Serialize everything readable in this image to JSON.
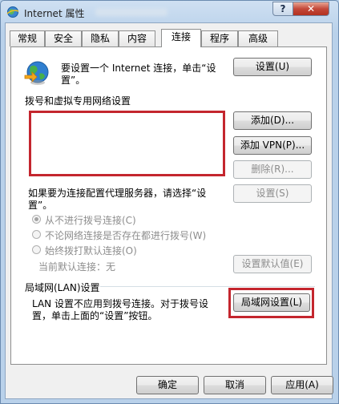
{
  "window": {
    "title": "Internet 属性",
    "help_label": "?",
    "close_label": "✕"
  },
  "tabs": [
    {
      "label": "常规"
    },
    {
      "label": "安全"
    },
    {
      "label": "隐私"
    },
    {
      "label": "内容"
    },
    {
      "label": "连接"
    },
    {
      "label": "程序"
    },
    {
      "label": "高级"
    }
  ],
  "setup": {
    "text_line1": "要设置一个 Internet 连接，单击“设",
    "text_line2": "置”。",
    "button": "设置(U)"
  },
  "dialup": {
    "section_title": "拨号和虚拟专用网络设置",
    "add_button": "添加(D)...",
    "add_vpn_button": "添加 VPN(P)...",
    "delete_button": "删除(R)...",
    "proxy_text_line1": "如果要为连接配置代理服务器，请选择“设",
    "proxy_text_line2": "置”。",
    "settings_button": "设置(S)",
    "options": [
      {
        "label": "从不进行拨号连接(C)",
        "checked": true
      },
      {
        "label": "不论网络连接是否存在都进行拨号(W)",
        "checked": false
      },
      {
        "label": "始终拨打默认连接(O)",
        "checked": false
      }
    ],
    "current_default": "当前默认连接：无",
    "set_default_button": "设置默认值(E)"
  },
  "lan": {
    "section_title": "局域网(LAN)设置",
    "text_line1": "LAN 设置不应用到拨号连接。对于拨号设",
    "text_line2": "置，单击上面的“设置”按钮。",
    "button": "局域网设置(L)"
  },
  "footer": {
    "ok_button": "确定",
    "cancel_button": "取消",
    "apply_button": "应用(A)"
  },
  "colors": {
    "highlight": "#c4262e",
    "titlebar": "#b9d1ea",
    "close": "#c4493a"
  }
}
